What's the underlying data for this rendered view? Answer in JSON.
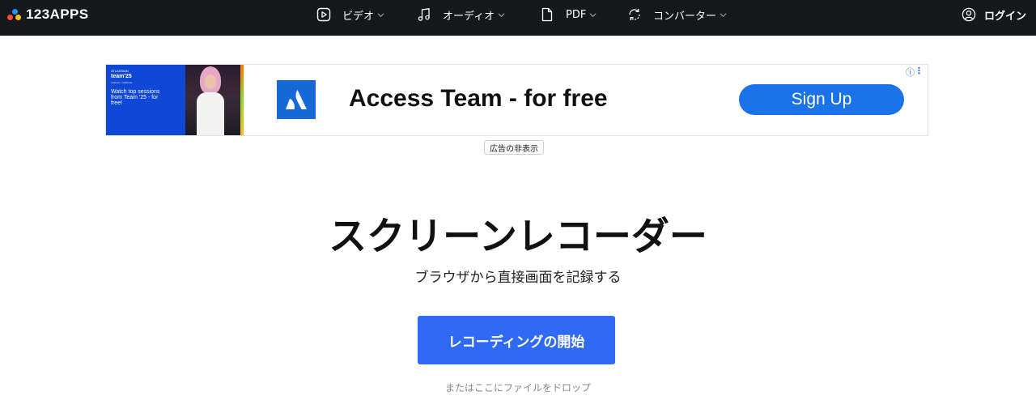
{
  "brand": {
    "logo_text": "123APPS"
  },
  "nav": {
    "items": [
      {
        "label": "ビデオ",
        "icon": "play-square-icon"
      },
      {
        "label": "オーディオ",
        "icon": "music-note-icon"
      },
      {
        "label": "PDF",
        "icon": "document-icon"
      },
      {
        "label": "コンバーター",
        "icon": "convert-cycle-icon"
      }
    ],
    "login_label": "ログイン",
    "login_icon": "user-circle-icon"
  },
  "ad": {
    "thumb_line1": "ATLASSIAN",
    "thumb_line2": "team'25",
    "thumb_line3": "Anaheim, California",
    "thumb_line4": "Watch top sessions from Team '25 - for free!",
    "headline": "Access Team - for free",
    "cta_label": "Sign Up",
    "info_icon": "ⓘ",
    "menu_icon": "⋮",
    "hide_label": "広告の非表示"
  },
  "main": {
    "title": "スクリーンレコーダー",
    "subtitle": "ブラウザから直接画面を記録する",
    "start_button_label": "レコーディングの開始",
    "drop_hint": "またはここにファイルをドロップ"
  },
  "colors": {
    "topbar_bg": "#16181c",
    "primary_button": "#2f6af4",
    "ad_cta": "#1a73e8"
  }
}
